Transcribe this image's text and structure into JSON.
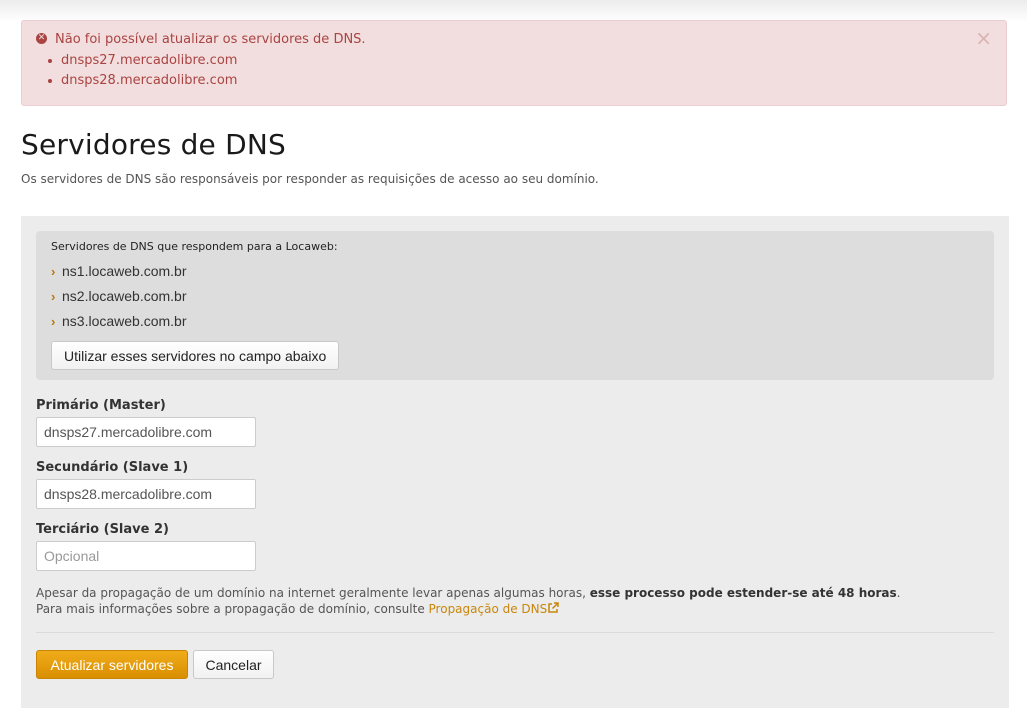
{
  "alert": {
    "message": "Não foi possível atualizar os servidores de DNS.",
    "items": [
      "dnsps27.mercadolibre.com",
      "dnsps28.mercadolibre.com"
    ],
    "close": "×"
  },
  "page": {
    "title": "Servidores de DNS",
    "description": "Os servidores de DNS são responsáveis por responder as requisições de acesso ao seu domínio."
  },
  "locaweb": {
    "caption": "Servidores de DNS que respondem para a Locaweb:",
    "servers": [
      "ns1.locaweb.com.br",
      "ns2.locaweb.com.br",
      "ns3.locaweb.com.br"
    ],
    "use_button": "Utilizar esses servidores no campo abaixo"
  },
  "form": {
    "primary": {
      "label": "Primário (Master)",
      "value": "dnsps27.mercadolibre.com"
    },
    "secondary": {
      "label": "Secundário (Slave 1)",
      "value": "dnsps28.mercadolibre.com"
    },
    "tertiary": {
      "label": "Terciário (Slave 2)",
      "value": "",
      "placeholder": "Opcional"
    }
  },
  "note": {
    "line1_prefix": "Apesar da propagação de um domínio na internet geralmente levar apenas algumas horas, ",
    "line1_bold": "esse processo pode estender-se até 48 horas",
    "line1_suffix": ".",
    "line2_prefix": "Para mais informações sobre a propagação de domínio, consulte ",
    "link": "Propagação de DNS"
  },
  "actions": {
    "submit": "Atualizar servidores",
    "cancel": "Cancelar"
  },
  "colors": {
    "alert_bg": "#f2dede",
    "alert_text": "#a94442",
    "accent": "#e09a0a",
    "link": "#c8870c"
  },
  "icons": [
    "error-circle-icon",
    "close-icon",
    "chevron-right-icon",
    "external-link-icon"
  ]
}
